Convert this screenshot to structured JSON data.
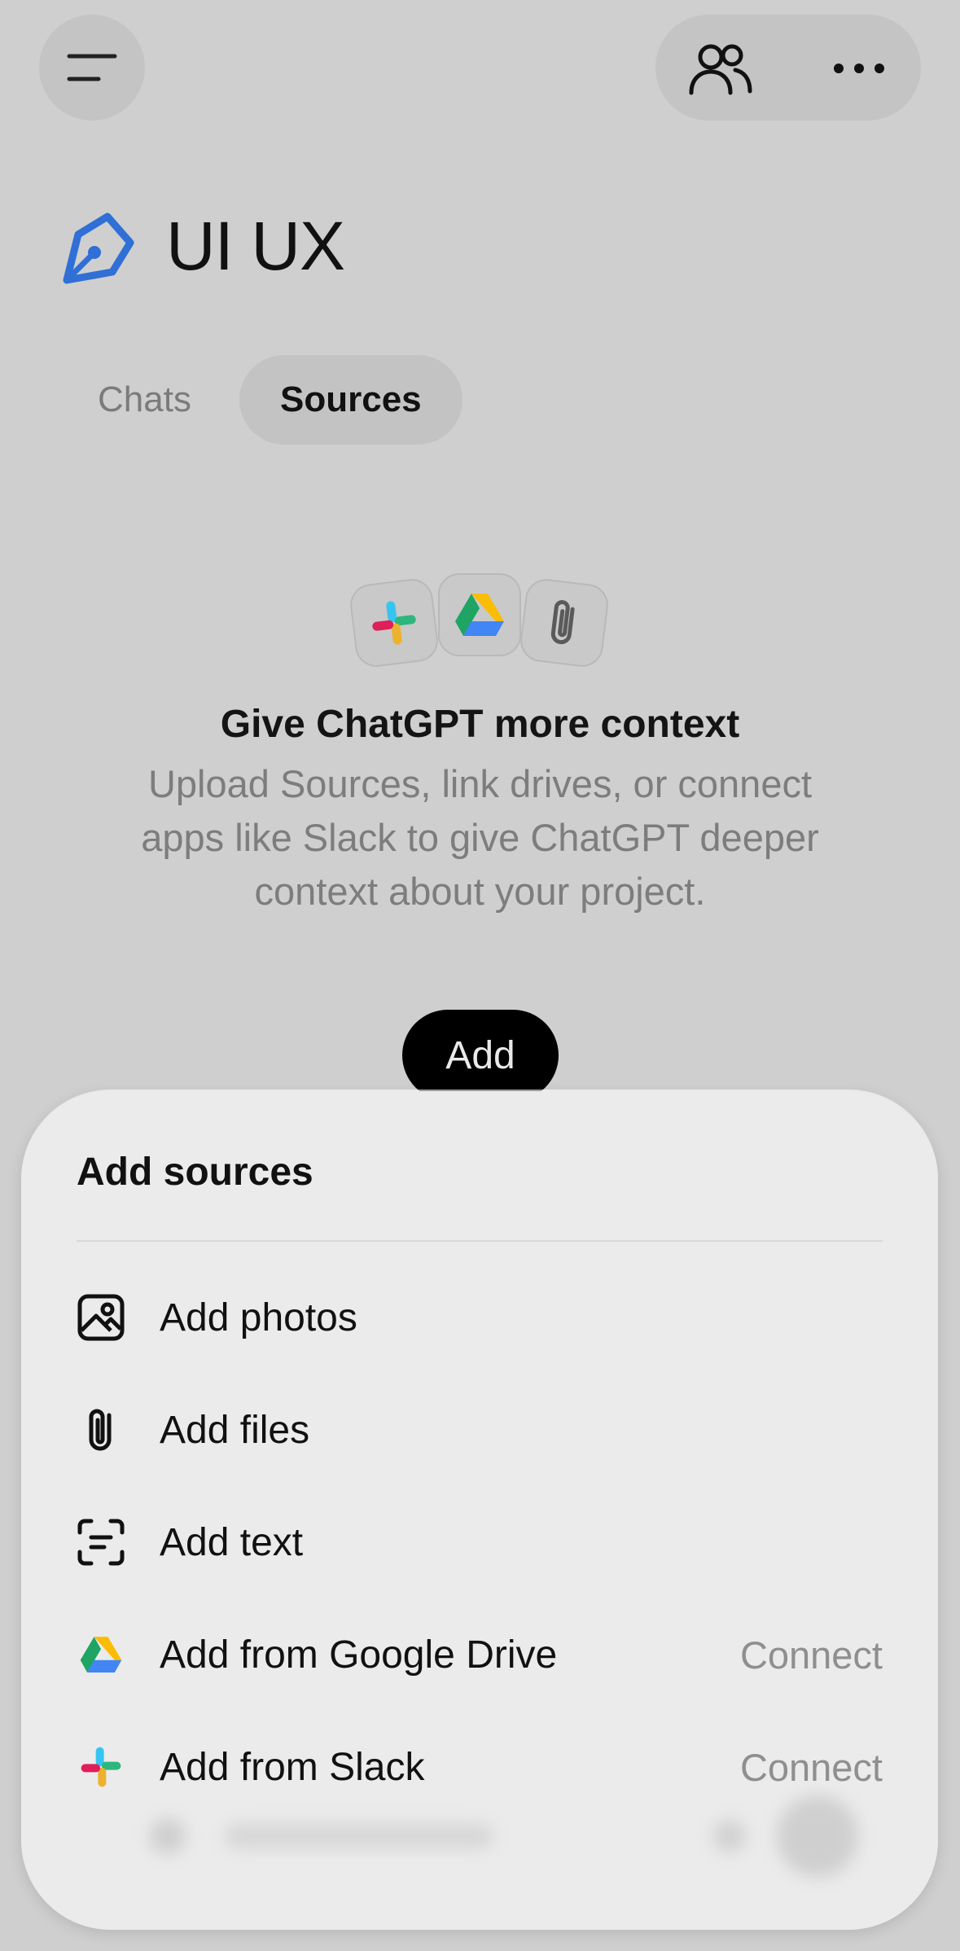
{
  "header": {
    "menu_icon": "menu-icon",
    "share_icon": "people-icon",
    "more_icon": "more-horizontal-icon"
  },
  "project": {
    "icon": "project-pen-icon",
    "title": "UI UX",
    "accent": "#2f6fd6"
  },
  "tabs": [
    {
      "label": "Chats",
      "selected": false
    },
    {
      "label": "Sources",
      "selected": true
    }
  ],
  "empty_state": {
    "icons": [
      "slack-icon",
      "google-drive-icon",
      "paperclip-icon"
    ],
    "title": "Give ChatGPT more context",
    "description": "Upload Sources, link drives, or connect apps like Slack to give ChatGPT deeper context about your project.",
    "add_label": "Add"
  },
  "sheet": {
    "title": "Add sources",
    "items": [
      {
        "label": "Add photos",
        "icon": "photo-icon",
        "action": ""
      },
      {
        "label": "Add files",
        "icon": "paperclip-icon",
        "action": ""
      },
      {
        "label": "Add text",
        "icon": "text-scan-icon",
        "action": ""
      },
      {
        "label": "Add from Google Drive",
        "icon": "google-drive-icon",
        "action": "Connect"
      },
      {
        "label": "Add from Slack",
        "icon": "slack-icon",
        "action": "Connect"
      }
    ]
  }
}
